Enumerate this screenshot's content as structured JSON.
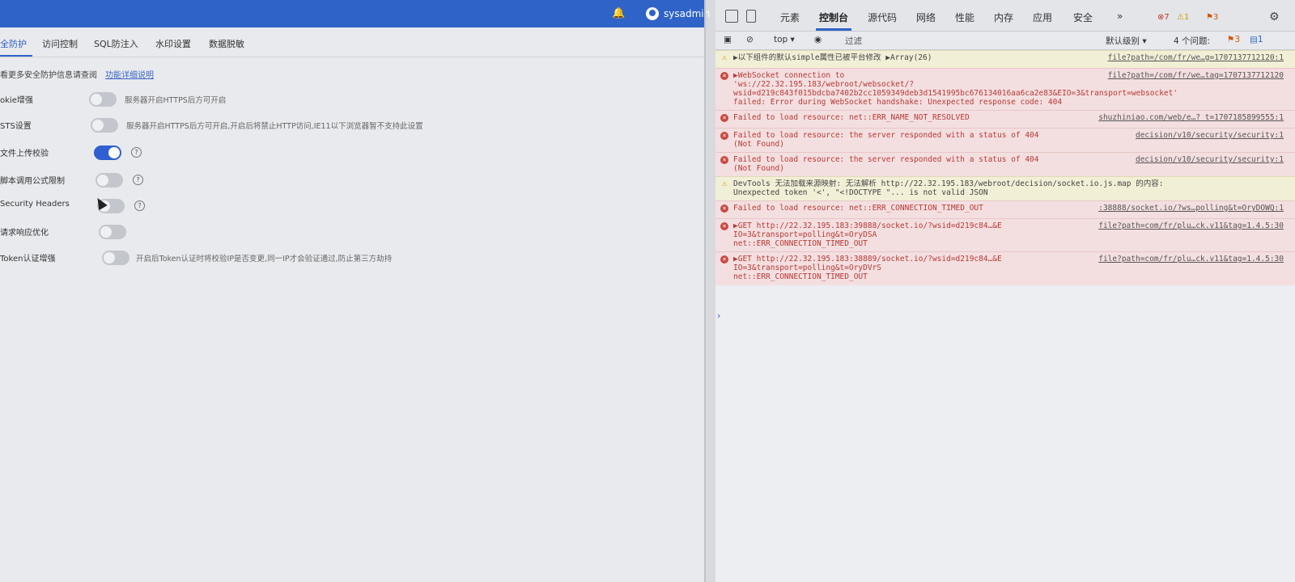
{
  "app": {
    "user": "sysadmin",
    "tabs": [
      "全防护",
      "访问控制",
      "SQL防注入",
      "水印设置",
      "数据脱敏"
    ],
    "hint": "看更多安全防护信息请查阅",
    "hint_link": "功能详细说明",
    "settings": [
      {
        "label": "okie增强",
        "on": false,
        "desc": "服务器开启HTTPS后方可开启",
        "help": false
      },
      {
        "label": "STS设置",
        "on": false,
        "desc": "服务器开启HTTPS后方可开启,开启后将禁止HTTP访问,IE11以下浏览器暂不支持此设置",
        "help": false
      },
      {
        "label": "文件上传校验",
        "on": true,
        "desc": "",
        "help": true
      },
      {
        "label": "脚本调用公式限制",
        "on": false,
        "desc": "",
        "help": true
      },
      {
        "label": "Security Headers",
        "on": false,
        "desc": "",
        "help": true
      },
      {
        "label": "请求响应优化",
        "on": false,
        "desc": "",
        "help": false
      },
      {
        "label": "Token认证增强",
        "on": false,
        "desc": "开启后Token认证时将校验IP是否变更,同一IP才会验证通过,防止第三方劫持",
        "help": false
      }
    ]
  },
  "devtools": {
    "tabs": [
      "元素",
      "控制台",
      "源代码",
      "网络",
      "性能",
      "内存",
      "应用",
      "安全"
    ],
    "active_tab": "控制台",
    "more": "»",
    "errors_badge": "7",
    "warnings_badge": "1",
    "issues_badge": "3",
    "toolbar": {
      "context": "top",
      "filter_placeholder": "过滤",
      "level": "默认级别",
      "issues": "4 个问题:",
      "issue_errors": "3",
      "issue_info": "1"
    },
    "messages": [
      {
        "type": "warn",
        "text": "▶以下组件的默认simple属性已被平台修改 ▶Array(26)",
        "src": "file?path=/com/fr/we…g=1707137712120:1"
      },
      {
        "type": "err",
        "text": "▶WebSocket connection to\n'ws://22.32.195.183/webroot/websocket/?\nwsid=d219c843f015bdcba7402b2cc1059349deb3d1541995bc676134016aa6ca2e83&EIO=3&transport=websocket'\nfailed: Error during WebSocket handshake: Unexpected response code: 404",
        "src": "file?path=/com/fr/we…tag=1707137712120"
      },
      {
        "type": "err",
        "text": "Failed to load resource: net::ERR_NAME_NOT_RESOLVED",
        "src": "shuzhiniao.com/web/e…? t=1707185899555:1"
      },
      {
        "type": "err",
        "text": "Failed to load resource: the server responded with a status of 404\n(Not Found)",
        "src": "decision/v10/security/security:1"
      },
      {
        "type": "err",
        "text": "Failed to load resource: the server responded with a status of 404\n(Not Found)",
        "src": "decision/v10/security/security:1"
      },
      {
        "type": "warn",
        "text": "DevTools 无法加载来源映射: 无法解析 http://22.32.195.183/webroot/decision/socket.io.js.map 的内容:\nUnexpected token '<', \"<!DOCTYPE \"... is not valid JSON",
        "src": ""
      },
      {
        "type": "err",
        "text": "Failed to load resource: net::ERR_CONNECTION_TIMED_OUT",
        "src": ":38888/socket.io/?ws…polling&t=OryDOWQ:1"
      },
      {
        "type": "err",
        "text": "▶GET http://22.32.195.183:39888/socket.io/?wsid=d219c84…&E\nIO=3&transport=polling&t=OryDSA\nnet::ERR_CONNECTION_TIMED_OUT",
        "src": "file?path=com/fr/plu…ck.v11&tag=1.4.5:30"
      },
      {
        "type": "err",
        "text": "▶GET http://22.32.195.183:38889/socket.io/?wsid=d219c84…&E\nIO=3&transport=polling&t=OryDVrS\nnet::ERR_CONNECTION_TIMED_OUT",
        "src": "file?path=com/fr/plu…ck.v11&tag=1.4.5:30"
      }
    ],
    "prompt": "›"
  }
}
